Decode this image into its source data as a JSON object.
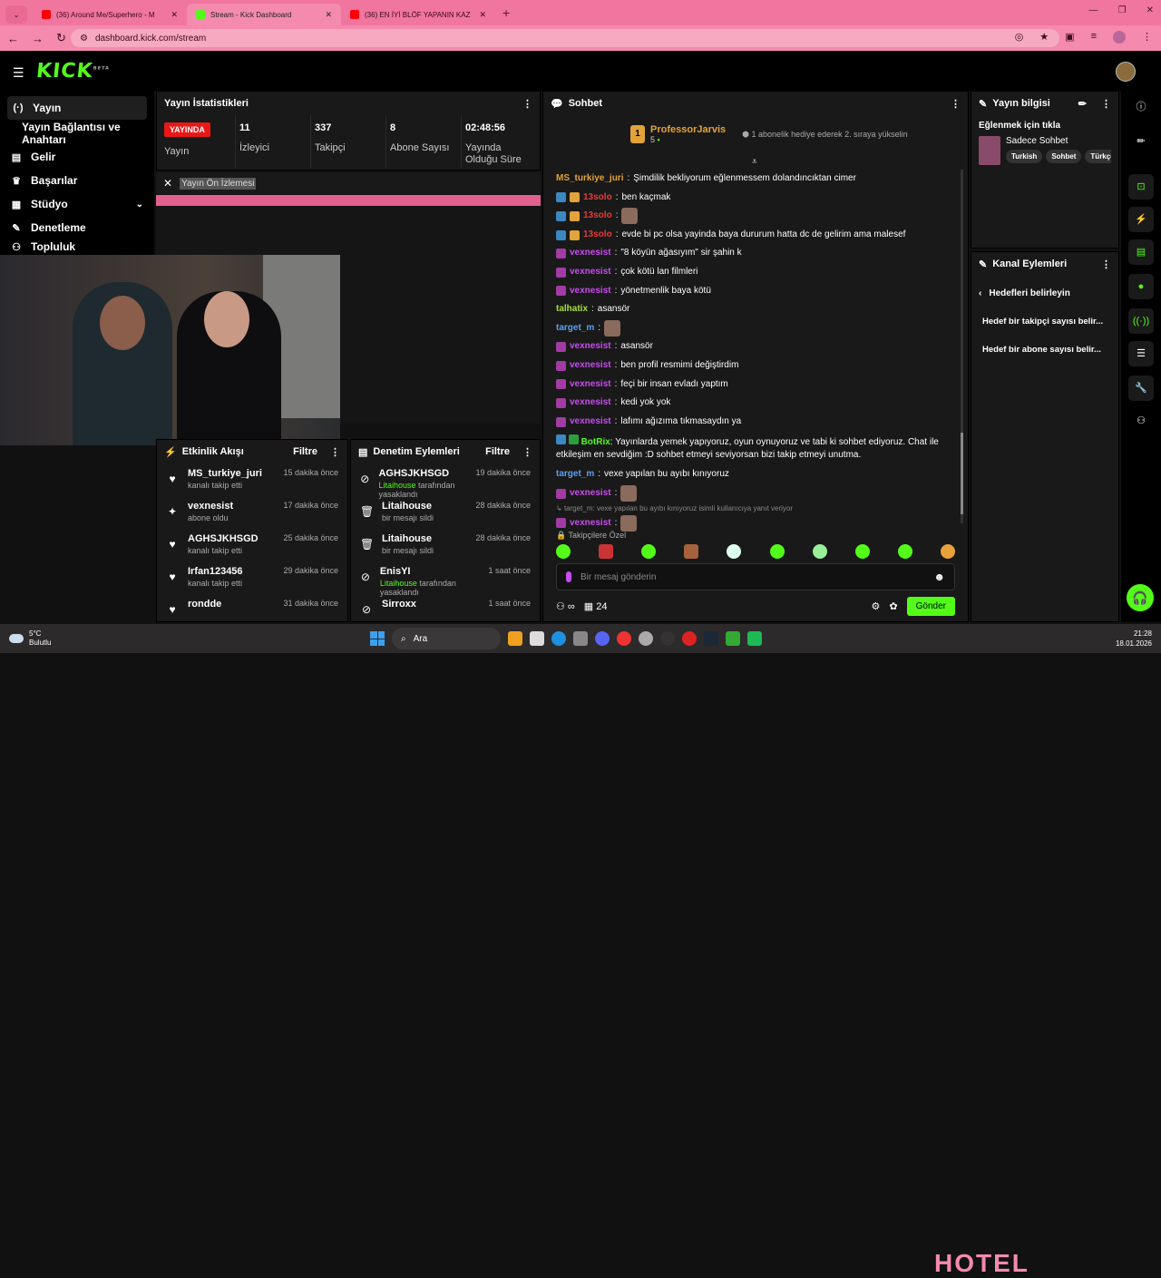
{
  "browser": {
    "tabs": [
      {
        "title": "(36) Around Me/Superhero - M",
        "fav": "#ff0000"
      },
      {
        "title": "Stream - Kick Dashboard",
        "fav": "#53fc18",
        "active": true
      },
      {
        "title": "(36) EN İYİ BLÖF YAPANIN KAZ",
        "fav": "#ff0000"
      }
    ],
    "url": "dashboard.kick.com/stream"
  },
  "brand": {
    "logo": "KICK",
    "beta": "BETA"
  },
  "sidenav": {
    "items": [
      {
        "label": "Yayın",
        "icon": "broadcast-icon",
        "glyph": "(·)"
      },
      {
        "label": "Yayın Bağlantısı ve Anahtarı"
      },
      {
        "label": "Gelir",
        "icon": "bars-icon",
        "glyph": "▤"
      },
      {
        "label": "Başarılar",
        "icon": "trophy-icon",
        "glyph": "♛"
      },
      {
        "label": "Stüdyo",
        "icon": "studio-icon",
        "glyph": "▦"
      },
      {
        "label": "Denetleme",
        "icon": "wrench-icon",
        "glyph": "✎"
      },
      {
        "label": "Topluluk",
        "icon": "community-icon",
        "glyph": "⚇"
      }
    ]
  },
  "stats": {
    "title": "Yayın İstatistikleri",
    "live": "YAYINDA",
    "live_label": "Yayın",
    "viewers": "11",
    "viewers_label": "İzleyici",
    "followers": "337",
    "followers_label": "Takipçi",
    "subs": "8",
    "subs_label": "Abone Sayısı",
    "uptime": "02:48:56",
    "uptime_label": "Yayında Olduğu Süre"
  },
  "preview": {
    "label": "Yayın Ön İzlemesi"
  },
  "activity": {
    "title": "Etkinlik Akışı",
    "filter": "Filtre",
    "events": [
      {
        "name": "MS_turkiye_juri",
        "sub": "kanalı takip etti",
        "time": "15 dakika önce",
        "glyph": "♥"
      },
      {
        "name": "vexnesist",
        "sub": "abone oldu",
        "time": "17 dakika önce",
        "glyph": "✦"
      },
      {
        "name": "AGHSJKHSGD",
        "sub": "kanalı takip etti",
        "time": "25 dakika önce",
        "glyph": "♥"
      },
      {
        "name": "Irfan123456",
        "sub": "kanalı takip etti",
        "time": "29 dakika önce",
        "glyph": "♥"
      },
      {
        "name": "rondde",
        "sub": "",
        "time": "31 dakika önce",
        "glyph": "♥"
      }
    ]
  },
  "moderation": {
    "title": "Denetim Eylemleri",
    "filter": "Filtre",
    "events": [
      {
        "name": "AGHSJKHSGD",
        "by": "Litaihouse",
        "sub": "tarafından yasaklandı",
        "time": "19 dakika önce",
        "glyph": "⊘"
      },
      {
        "name": "Litaihouse",
        "by": "",
        "sub": "bir mesajı sildi",
        "time": "28 dakika önce",
        "glyph": "🗑"
      },
      {
        "name": "Litaihouse",
        "by": "",
        "sub": "bir mesajı sildi",
        "time": "28 dakika önce",
        "glyph": "🗑"
      },
      {
        "name": "EnisYI",
        "by": "Litaihouse",
        "sub": "tarafından yasaklandı",
        "time": "1 saat önce",
        "glyph": "⊘"
      },
      {
        "name": "Sirroxx",
        "by": "",
        "sub": "",
        "time": "1 saat önce",
        "glyph": "⊘"
      }
    ]
  },
  "chat": {
    "title": "Sohbet",
    "pinned": {
      "rank": "1",
      "name": "ProfessorJarvis",
      "count": "5",
      "info": "1 abonelik hediye ederek 2. sıraya yükselin"
    },
    "messages": [
      {
        "user": "MS_turkiye_juri",
        "color": "#e2a33a",
        "text": "Şimdilik bekliyorum eğlenmessem dolandıncıktan cimer",
        "badges": []
      },
      {
        "user": "13solo",
        "color": "#e83a3a",
        "text": "ben kaçmak",
        "badges": [
          "b-blue",
          "b-gold"
        ]
      },
      {
        "user": "13solo",
        "color": "#e83a3a",
        "text": "",
        "emote": true,
        "badges": [
          "b-blue",
          "b-gold"
        ]
      },
      {
        "user": "13solo",
        "color": "#e83a3a",
        "text": "evde bi pc olsa yayinda baya dururum hatta dc de gelirim ama malesef",
        "badges": [
          "b-blue",
          "b-gold"
        ]
      },
      {
        "user": "vexnesist",
        "color": "#c84cf0",
        "text": "\"8 köyün ağasıyım\" sir şahin k",
        "badges": [
          "b-pink"
        ]
      },
      {
        "user": "vexnesist",
        "color": "#c84cf0",
        "text": "çok kötü lan filmleri",
        "badges": [
          "b-pink"
        ]
      },
      {
        "user": "vexnesist",
        "color": "#c84cf0",
        "text": "yönetmenlik baya kötü",
        "badges": [
          "b-pink"
        ]
      },
      {
        "user": "talhatix",
        "color": "#a8e03a",
        "text": "asansör",
        "badges": []
      },
      {
        "user": "target_m",
        "color": "#5aa0f0",
        "text": "",
        "emote": true,
        "badges": []
      },
      {
        "user": "vexnesist",
        "color": "#c84cf0",
        "text": "asansör",
        "badges": [
          "b-pink"
        ]
      },
      {
        "user": "vexnesist",
        "color": "#c84cf0",
        "text": "ben profil resmimi değiştirdim",
        "badges": [
          "b-pink"
        ]
      },
      {
        "user": "vexnesist",
        "color": "#c84cf0",
        "text": "feçi bir insan evladı yaptım",
        "badges": [
          "b-pink"
        ]
      },
      {
        "user": "vexnesist",
        "color": "#c84cf0",
        "text": "kedi yok yok",
        "badges": [
          "b-pink"
        ]
      },
      {
        "user": "vexnesist",
        "color": "#c84cf0",
        "text": "lafımı ağızıma tıkmasaydın ya",
        "badges": [
          "b-pink"
        ]
      }
    ],
    "botrix": {
      "user": "BotRix",
      "text": "Yayınlarda yemek yapıyoruz, oyun oynuyoruz ve tabi ki sohbet ediyoruz. Chat ile etkileşim en sevdiğim :D sohbet etmeyi seviyorsan bizi takip etmeyi unutma."
    },
    "target_msg": {
      "user": "target_m",
      "text": "vexe yapılan bu ayıbı kınıyoruz"
    },
    "vex_emote1": {
      "user": "vexnesist"
    },
    "reply": "target_m: vexe yapılan bu ayıbı kınıyoruz isimli kullanıcıya yanıt veriyor",
    "vex_emote2": {
      "user": "vexnesist"
    },
    "followers_only": "Takipçilere Özel",
    "input_placeholder": "Bir mesaj gönderin",
    "count": "24",
    "send": "Gönder"
  },
  "info_panel": {
    "title": "Yayın bilgisi",
    "stream_title": "Eğlenmek için tıkla",
    "category": "Sadece Sohbet",
    "tags": [
      "Turkish",
      "Sohbet",
      "Türkçe"
    ]
  },
  "channel_actions": {
    "title": "Kanal Eylemleri",
    "back": "Hedefleri belirleyin",
    "items": [
      "Hedef bir takipçi sayısı belir...",
      "Hedef bir abone sayısı belir..."
    ]
  },
  "taskbar": {
    "temp": "5°C",
    "weather": "Bulutlu",
    "search": "Ara",
    "time": "21:28",
    "date": "18.01.2026",
    "banner": "HOTEL"
  },
  "colors": {
    "accent": "#53fc18",
    "live": "#e81818",
    "chrome": "#f0759f"
  }
}
